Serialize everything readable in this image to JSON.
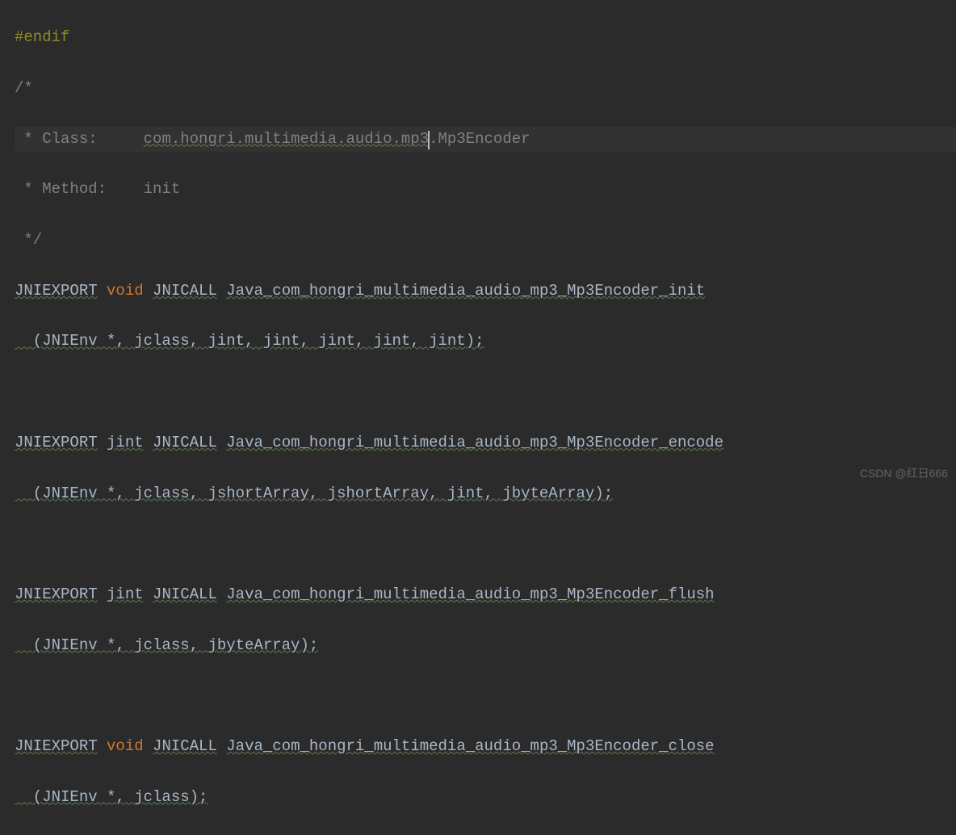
{
  "code": {
    "preproc_endif": "#endif",
    "comment_open": "/*",
    "comment_class_label": " * Class:     ",
    "comment_class_value_a": "com.hongri.multimedia.audio.mp3",
    "comment_class_value_b": ".Mp3Encoder",
    "comment_method": " * Method:    init",
    "comment_close": " */",
    "jniexport": "JNIEXPORT",
    "jnicall": "JNICALL",
    "kw_void": "void",
    "kw_jint": "jint",
    "func_init": "Java_com_hongri_multimedia_audio_mp3_Mp3Encoder_init",
    "params_init": "  (JNIEnv *, jclass, jint, jint, jint, jint, jint);",
    "func_encode": "Java_com_hongri_multimedia_audio_mp3_Mp3Encoder_encode",
    "params_encode": "  (JNIEnv *, jclass, jshortArray, jshortArray, jint, jbyteArray);",
    "func_flush": "Java_com_hongri_multimedia_audio_mp3_Mp3Encoder_flush",
    "params_flush": "  (JNIEnv *, jclass, jbyteArray);",
    "func_close": "Java_com_hongri_multimedia_audio_mp3_Mp3Encoder_close",
    "params_close": "  (JNIEnv *, jclass);"
  },
  "watermark": "CSDN @红日666"
}
